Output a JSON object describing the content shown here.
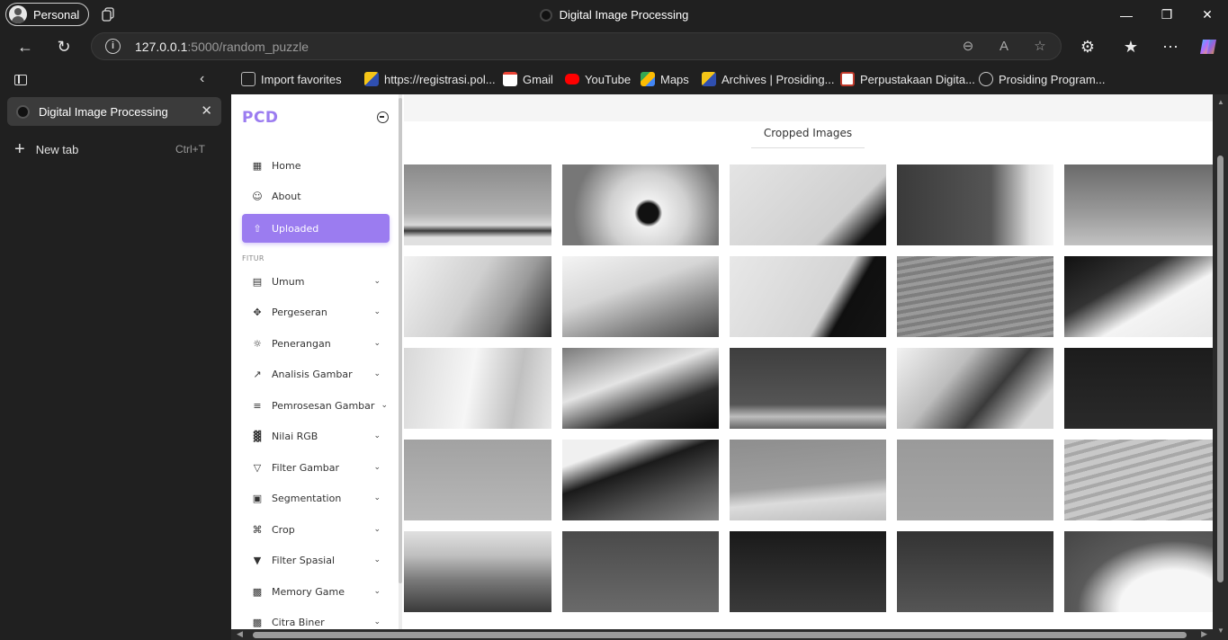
{
  "titlebar": {
    "profile_label": "Personal",
    "window_title": "Digital Image Processing",
    "controls": [
      "minimize-icon",
      "restore-icon",
      "close-icon"
    ]
  },
  "nav": {
    "back_icon": "back-arrow-icon",
    "refresh_icon": "refresh-icon",
    "url_host": "127.0.0.1",
    "url_rest": ":5000/random_puzzle",
    "omnibox_icons": [
      "zoom-out-icon",
      "read-aloud-icon",
      "favorite-star-icon"
    ],
    "toolbar_icons": [
      "extensions-icon",
      "favorites-icon",
      "more-icon",
      "copilot-icon"
    ]
  },
  "favorites": [
    {
      "label": "Import favorites",
      "icon": "import-icon",
      "color": "#7a7a7a"
    },
    {
      "label": "https://registrasi.pol...",
      "icon": "site-logo-icon",
      "color": "#2f4fb0"
    },
    {
      "label": "Gmail",
      "icon": "gmail-icon",
      "color": "#ea4335"
    },
    {
      "label": "YouTube",
      "icon": "youtube-icon",
      "color": "#ff0000"
    },
    {
      "label": "Maps",
      "icon": "maps-icon",
      "color": "#34a853"
    },
    {
      "label": "Archives | Prosiding...",
      "icon": "site-logo-icon",
      "color": "#2f4fb0"
    },
    {
      "label": "Perpustakaan Digita...",
      "icon": "library-icon",
      "color": "#e8e8e8"
    },
    {
      "label": "Prosiding Program...",
      "icon": "globe-icon",
      "color": "#cccccc"
    }
  ],
  "tabs_pane": {
    "active_tab": "Digital Image Processing",
    "new_tab_label": "New tab",
    "new_tab_shortcut": "Ctrl+T"
  },
  "sidebar": {
    "brand": "PCD",
    "section_label": "FITUR",
    "accent": "#9b7cf0",
    "top_items": [
      {
        "label": "Home",
        "icon": "grid-icon"
      },
      {
        "label": "About",
        "icon": "user-icon"
      },
      {
        "label": "Uploaded",
        "icon": "upload-icon",
        "active": true
      }
    ],
    "feature_items": [
      {
        "label": "Umum",
        "icon": "list-icon"
      },
      {
        "label": "Pergeseran",
        "icon": "move-icon"
      },
      {
        "label": "Penerangan",
        "icon": "sun-icon"
      },
      {
        "label": "Analisis Gambar",
        "icon": "line-chart-icon"
      },
      {
        "label": "Pemrosesan Gambar",
        "icon": "sliders-icon"
      },
      {
        "label": "Nilai RGB",
        "icon": "bar-chart-icon"
      },
      {
        "label": "Filter Gambar",
        "icon": "filter-icon"
      },
      {
        "label": "Segmentation",
        "icon": "segment-icon"
      },
      {
        "label": "Crop",
        "icon": "crop-icon"
      },
      {
        "label": "Filter Spasial",
        "icon": "funnel-icon"
      },
      {
        "label": "Memory Game",
        "icon": "gamepad-icon"
      },
      {
        "label": "Citra Biner",
        "icon": "image-icon"
      }
    ]
  },
  "main": {
    "heading": "Cropped Images",
    "tiles": [
      {
        "tone": "desert-sky"
      },
      {
        "tone": "camel-eye"
      },
      {
        "tone": "pale-sky-dark-edge"
      },
      {
        "tone": "dark-fur-edge"
      },
      {
        "tone": "gray-sky"
      },
      {
        "tone": "fur-white"
      },
      {
        "tone": "camel-eye-lower"
      },
      {
        "tone": "sky-dark-diagonal"
      },
      {
        "tone": "sand-ripples"
      },
      {
        "tone": "muzzle-dark"
      },
      {
        "tone": "fur-light"
      },
      {
        "tone": "fur-contrast"
      },
      {
        "tone": "dark-sky-ear"
      },
      {
        "tone": "chin-fur"
      },
      {
        "tone": "dark-solid"
      },
      {
        "tone": "flat-gray"
      },
      {
        "tone": "dark-neck-sand"
      },
      {
        "tone": "dune-light"
      },
      {
        "tone": "flat-gray-2"
      },
      {
        "tone": "sand-tracks"
      },
      {
        "tone": "desert-figure"
      },
      {
        "tone": "dark-gray-sky"
      },
      {
        "tone": "dark-fade"
      },
      {
        "tone": "dark-fade-2"
      },
      {
        "tone": "white-hump"
      }
    ]
  }
}
